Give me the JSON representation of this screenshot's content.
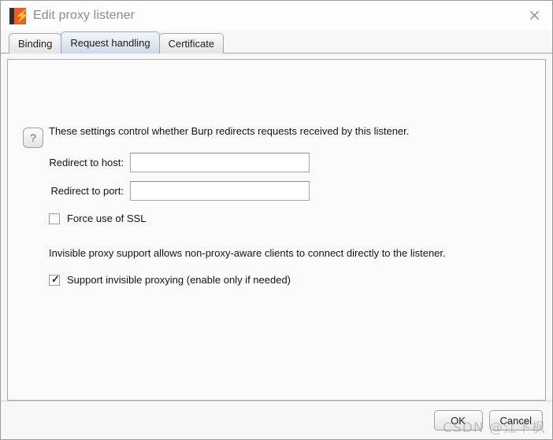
{
  "window": {
    "title": "Edit proxy listener",
    "app_icon": "burp-suite-icon",
    "close_icon": "close-icon"
  },
  "tabs": [
    {
      "label": "Binding",
      "selected": false
    },
    {
      "label": "Request handling",
      "selected": true
    },
    {
      "label": "Certificate",
      "selected": false
    }
  ],
  "content": {
    "help_button_label": "?",
    "intro_text": "These settings control whether Burp redirects requests received by this listener.",
    "fields": [
      {
        "label": "Redirect to host:",
        "value": "",
        "placeholder": ""
      },
      {
        "label": "Redirect to port:",
        "value": "",
        "placeholder": ""
      }
    ],
    "force_ssl": {
      "label": "Force use of SSL",
      "checked": false,
      "mark": ""
    },
    "note_text": "Invisible proxy support allows non-proxy-aware clients to connect directly to the listener.",
    "invisible_proxy": {
      "label": "Support invisible proxying (enable only if needed)",
      "checked": true,
      "mark": "✓"
    }
  },
  "footer": {
    "ok_label": "OK",
    "cancel_label": "Cancel"
  },
  "watermark": {
    "text": "CSDN @江下枫"
  },
  "colors": {
    "accent_orange": "#f05a28",
    "title_text": "#8b8b8b",
    "tab_selected_border": "#8fa8bd",
    "panel_bg": "#fafafa",
    "window_bg": "#f7f7f7"
  }
}
